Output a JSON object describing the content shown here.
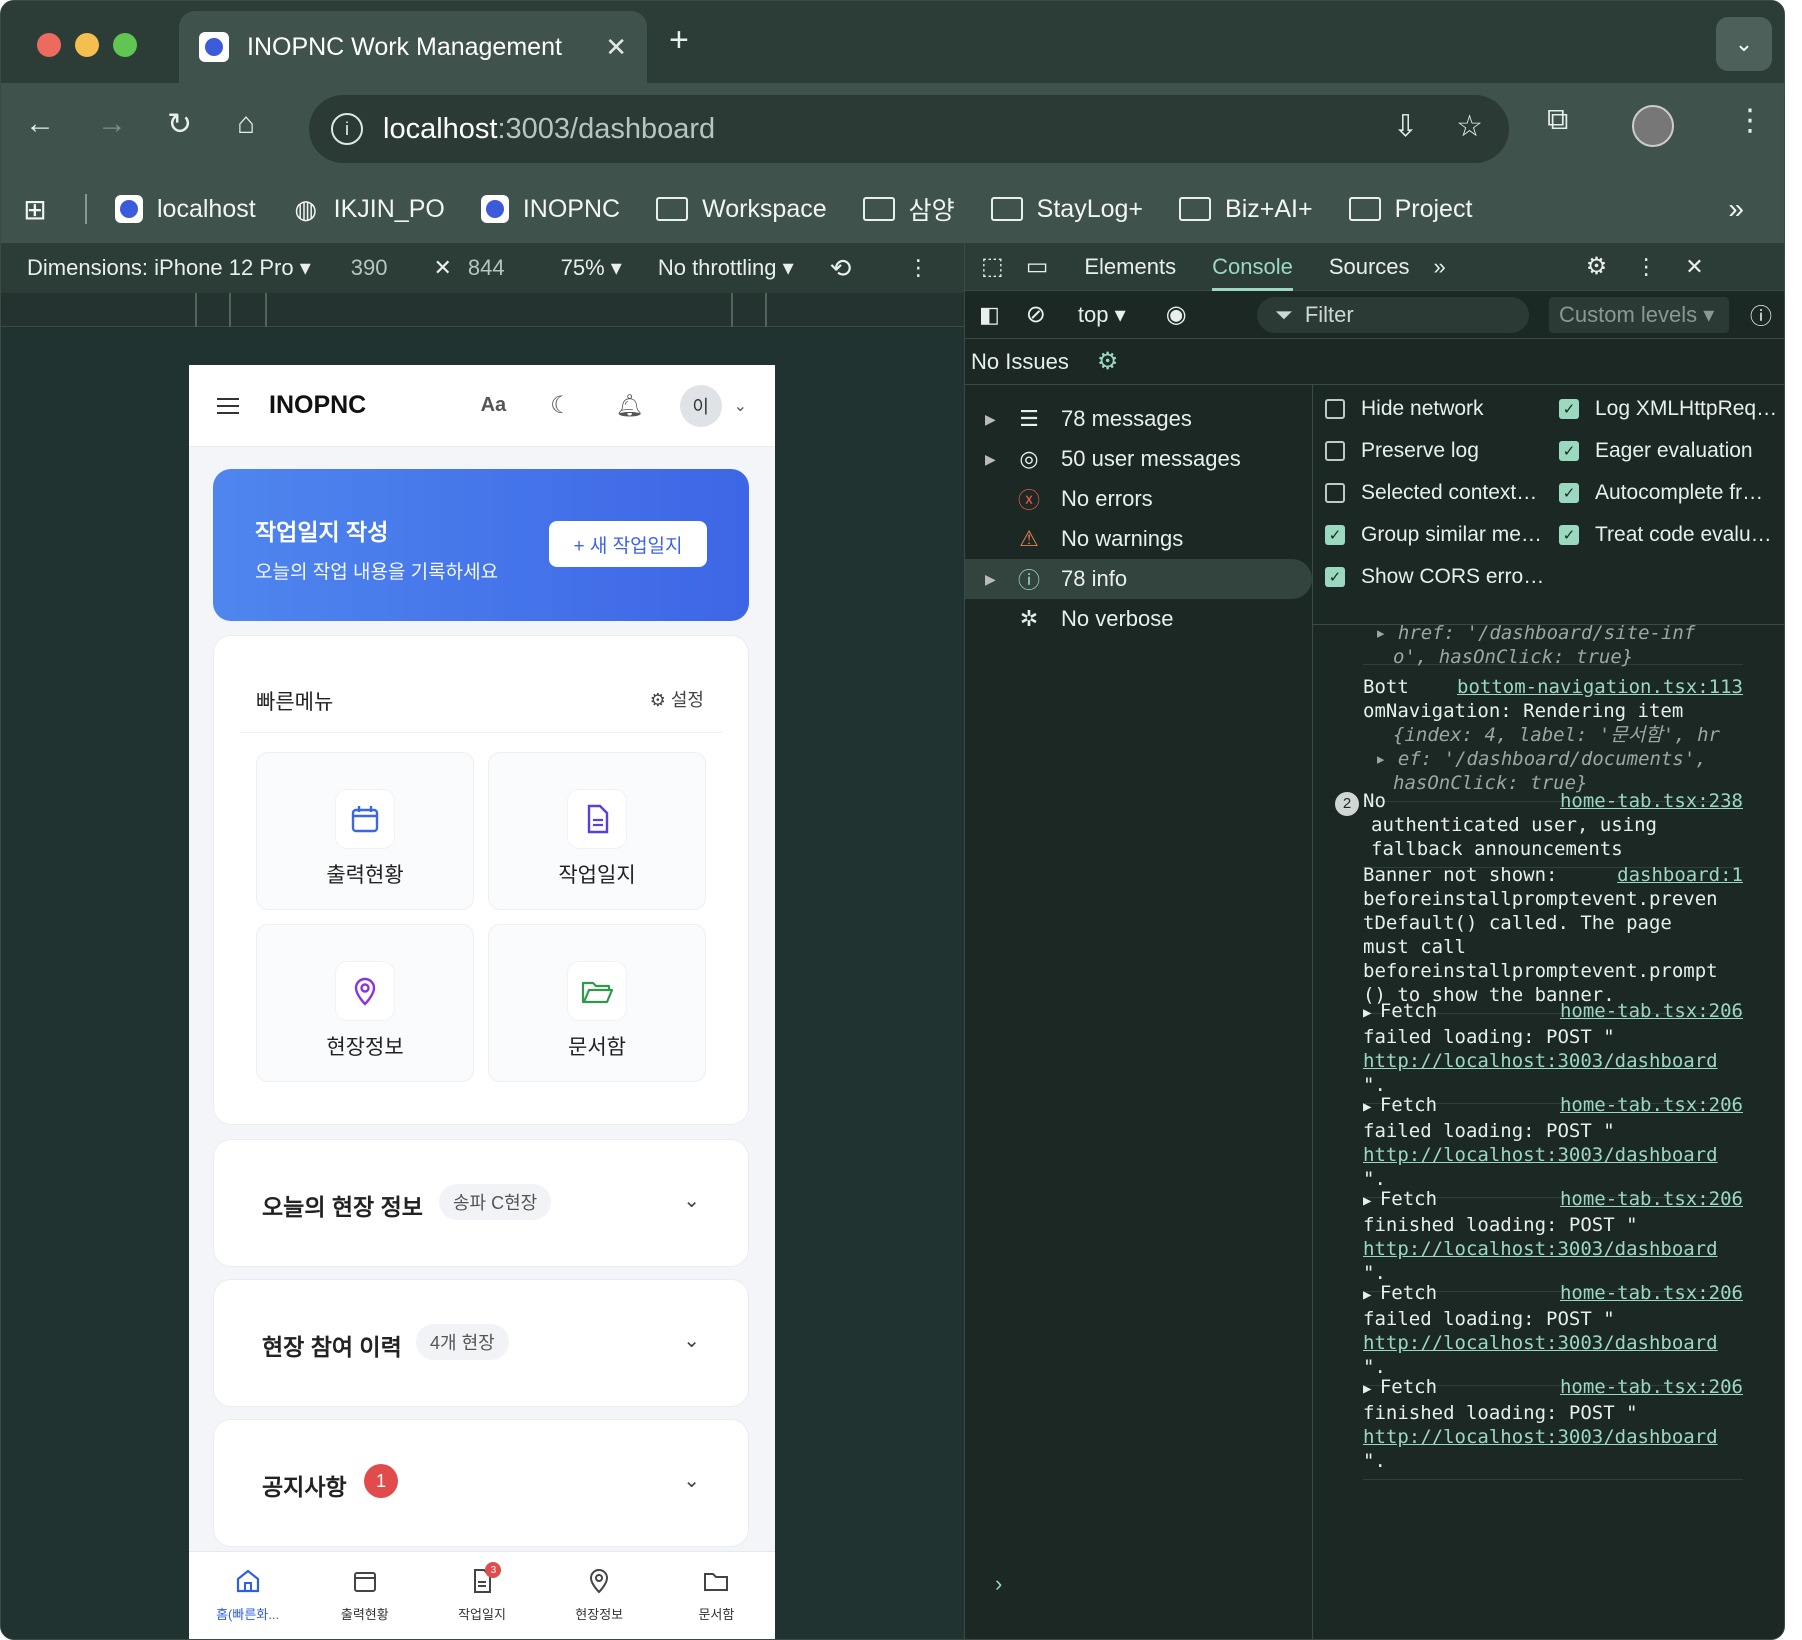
{
  "browser": {
    "tab_title": "INOPNC Work Management",
    "url_host": "localhost",
    "url_path": ":3003/dashboard",
    "bookmarks": [
      "localhost",
      "IKJIN_PO",
      "INOPNC",
      "Workspace",
      "삼양",
      "StayLog+",
      "Biz+AI+",
      "Project"
    ]
  },
  "device_toolbar": {
    "dimensions_label": "Dimensions: iPhone 12 Pro",
    "width": "390",
    "height": "844",
    "zoom": "75%",
    "throttling": "No throttling"
  },
  "app": {
    "brand": "INOPNC",
    "font_btn": "Aa",
    "avatar": "이",
    "banner": {
      "title": "작업일지 작성",
      "subtitle": "오늘의 작업 내용을 기록하세요",
      "button": "+ 새 작업일지"
    },
    "quick_menu": {
      "title": "빠른메뉴",
      "settings": "설정",
      "tiles": [
        "출력현황",
        "작업일지",
        "현장정보",
        "문서함"
      ]
    },
    "site_info": {
      "title": "오늘의 현장 정보",
      "pill": "송파 C현장"
    },
    "history": {
      "title": "현장 참여 이력",
      "pill": "4개 현장"
    },
    "notice": {
      "title": "공지사항",
      "count": "1"
    },
    "bottom_nav": [
      "홈(빠른화...",
      "출력현황",
      "작업일지",
      "현장정보",
      "문서함"
    ],
    "bottom_nav_badge": "3",
    "colors": {
      "primary": "#3d66e6",
      "accent_red": "#e24b4b"
    }
  },
  "devtools": {
    "tabs": [
      "Elements",
      "Console",
      "Sources"
    ],
    "context": "top",
    "filter_placeholder": "Filter",
    "levels": "Custom levels",
    "issues": "No Issues",
    "sidebar": [
      {
        "label": "78 messages",
        "icon": "list-icon"
      },
      {
        "label": "50 user messages",
        "icon": "user-icon"
      },
      {
        "label": "No errors",
        "icon": "error-icon"
      },
      {
        "label": "No warnings",
        "icon": "warning-icon"
      },
      {
        "label": "78 info",
        "icon": "info-icon"
      },
      {
        "label": "No verbose",
        "icon": "bug-icon"
      }
    ],
    "settings": {
      "left": [
        {
          "label": "Hide network",
          "checked": false
        },
        {
          "label": "Preserve log",
          "checked": false
        },
        {
          "label": "Selected context…",
          "checked": false
        },
        {
          "label": "Group similar me…",
          "checked": true
        },
        {
          "label": "Show CORS erro…",
          "checked": true
        }
      ],
      "right": [
        {
          "label": "Log XMLHttpReq…",
          "checked": true
        },
        {
          "label": "Eager evaluation",
          "checked": true
        },
        {
          "label": "Autocomplete fr…",
          "checked": true
        },
        {
          "label": "Treat code evalu…",
          "checked": true
        }
      ]
    },
    "log": {
      "top_fragment_1": "href: '/dashboard/site-inf",
      "top_fragment_2": "o', hasOnClick: true}",
      "bott_prefix": "Bott",
      "bott_src": "bottom-navigation.tsx:113",
      "bott_line1": "omNavigation: Rendering item",
      "bott_line2": "{index: 4, label: '문서함', hr",
      "bott_line3": "ef: '/dashboard/documents',",
      "bott_line4": "hasOnClick: true}",
      "auth_count": "2",
      "auth_prefix": "No",
      "auth_src": "home-tab.tsx:238",
      "auth_line1": "authenticated user, using",
      "auth_line2": "fallback announcements",
      "banner_prefix": "Banner not shown:",
      "banner_src": "dashboard:1",
      "banner_l1": "beforeinstallpromptevent.preven",
      "banner_l2": "tDefault() called. The page",
      "banner_l3": "must call",
      "banner_l4": "beforeinstallpromptevent.prompt",
      "banner_l5": "() to show the banner.",
      "fetch_src": "home-tab.tsx:206",
      "fetch_url": "http://localhost:3003/dashboard",
      "fetches": [
        {
          "state": "failed loading: POST \""
        },
        {
          "state": "failed loading: POST \""
        },
        {
          "state": "finished loading: POST \""
        },
        {
          "state": "failed loading: POST \""
        },
        {
          "state": "finished loading: POST \""
        }
      ],
      "fetch_word": "Fetch",
      "fetch_end": "\"."
    }
  }
}
